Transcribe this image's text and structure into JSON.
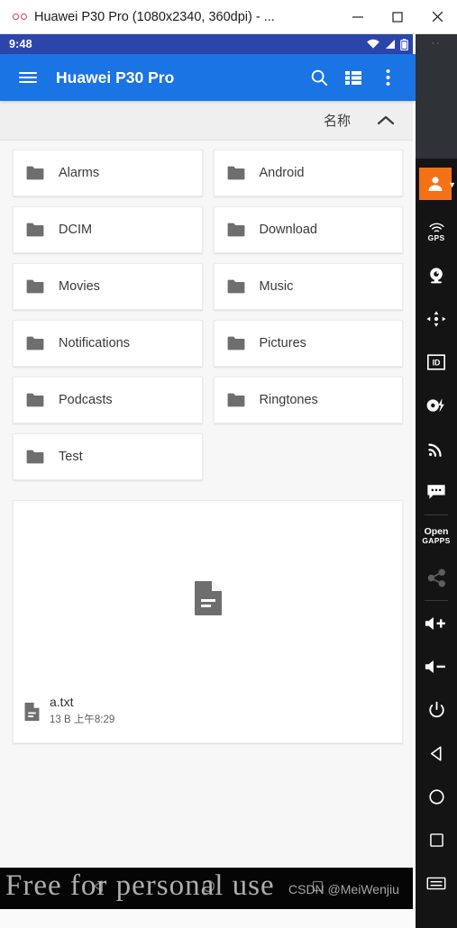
{
  "window": {
    "title": "Huawei P30 Pro (1080x2340, 360dpi) - ...",
    "app_icon": "genymotion-icon",
    "minimize_label": "—",
    "maximize_label": "□",
    "close_label": "✕"
  },
  "device": {
    "statusbar": {
      "time": "9:48",
      "icons": [
        "wifi-off-icon",
        "cellular-signal-icon",
        "battery-icon"
      ]
    },
    "appbar": {
      "menu_icon": "hamburger-menu-icon",
      "title": "Huawei P30 Pro",
      "search_icon": "search-icon",
      "view_icon": "list-view-icon",
      "overflow_icon": "more-vertical-icon",
      "background": "#1b74e4"
    },
    "sortbar": {
      "label": "名称",
      "direction_icon": "chevron-up-icon"
    },
    "folders": [
      {
        "name": "Alarms",
        "icon": "folder-icon"
      },
      {
        "name": "Android",
        "icon": "folder-icon"
      },
      {
        "name": "DCIM",
        "icon": "folder-icon"
      },
      {
        "name": "Download",
        "icon": "folder-icon"
      },
      {
        "name": "Movies",
        "icon": "folder-icon"
      },
      {
        "name": "Music",
        "icon": "folder-icon"
      },
      {
        "name": "Notifications",
        "icon": "folder-icon"
      },
      {
        "name": "Pictures",
        "icon": "folder-icon"
      },
      {
        "name": "Podcasts",
        "icon": "folder-icon"
      },
      {
        "name": "Ringtones",
        "icon": "folder-icon"
      },
      {
        "name": "Test",
        "icon": "folder-icon"
      }
    ],
    "file": {
      "name": "a.txt",
      "details": "13 B 上午8:29",
      "thumb_icon": "document-icon",
      "small_icon": "document-icon"
    },
    "navbar": {
      "back_icon": "back-triangle-icon",
      "home_icon": "home-circle-icon",
      "recents_icon": "recents-square-icon",
      "watermark": "Free for personal use",
      "credit": "CSDN @MeiWenjiu"
    }
  },
  "toolbar": {
    "top_dots": "··",
    "avatar_icon": "account-icon",
    "avatar_color": "#f47216",
    "expand_icon": "chevron-down-icon",
    "items": [
      {
        "icon": "gps-icon",
        "label": "GPS"
      },
      {
        "icon": "webcam-icon",
        "label": ""
      },
      {
        "icon": "dpad-icon",
        "label": ""
      },
      {
        "icon": "id-icon",
        "label": ""
      },
      {
        "icon": "disk-io-icon",
        "label": ""
      },
      {
        "icon": "network-signal-icon",
        "label": ""
      },
      {
        "icon": "sms-icon",
        "label": ""
      }
    ],
    "gapps": {
      "line1": "Open",
      "line2": "GAPPS",
      "icon": "open-gapps-icon"
    },
    "share": {
      "icon": "share-icon"
    },
    "controls": [
      {
        "icon": "volume-up-icon"
      },
      {
        "icon": "volume-down-icon"
      },
      {
        "icon": "power-icon"
      },
      {
        "icon": "back-triangle-icon"
      },
      {
        "icon": "home-circle-icon"
      },
      {
        "icon": "recents-square-icon"
      },
      {
        "icon": "keyboard-icon"
      }
    ]
  }
}
